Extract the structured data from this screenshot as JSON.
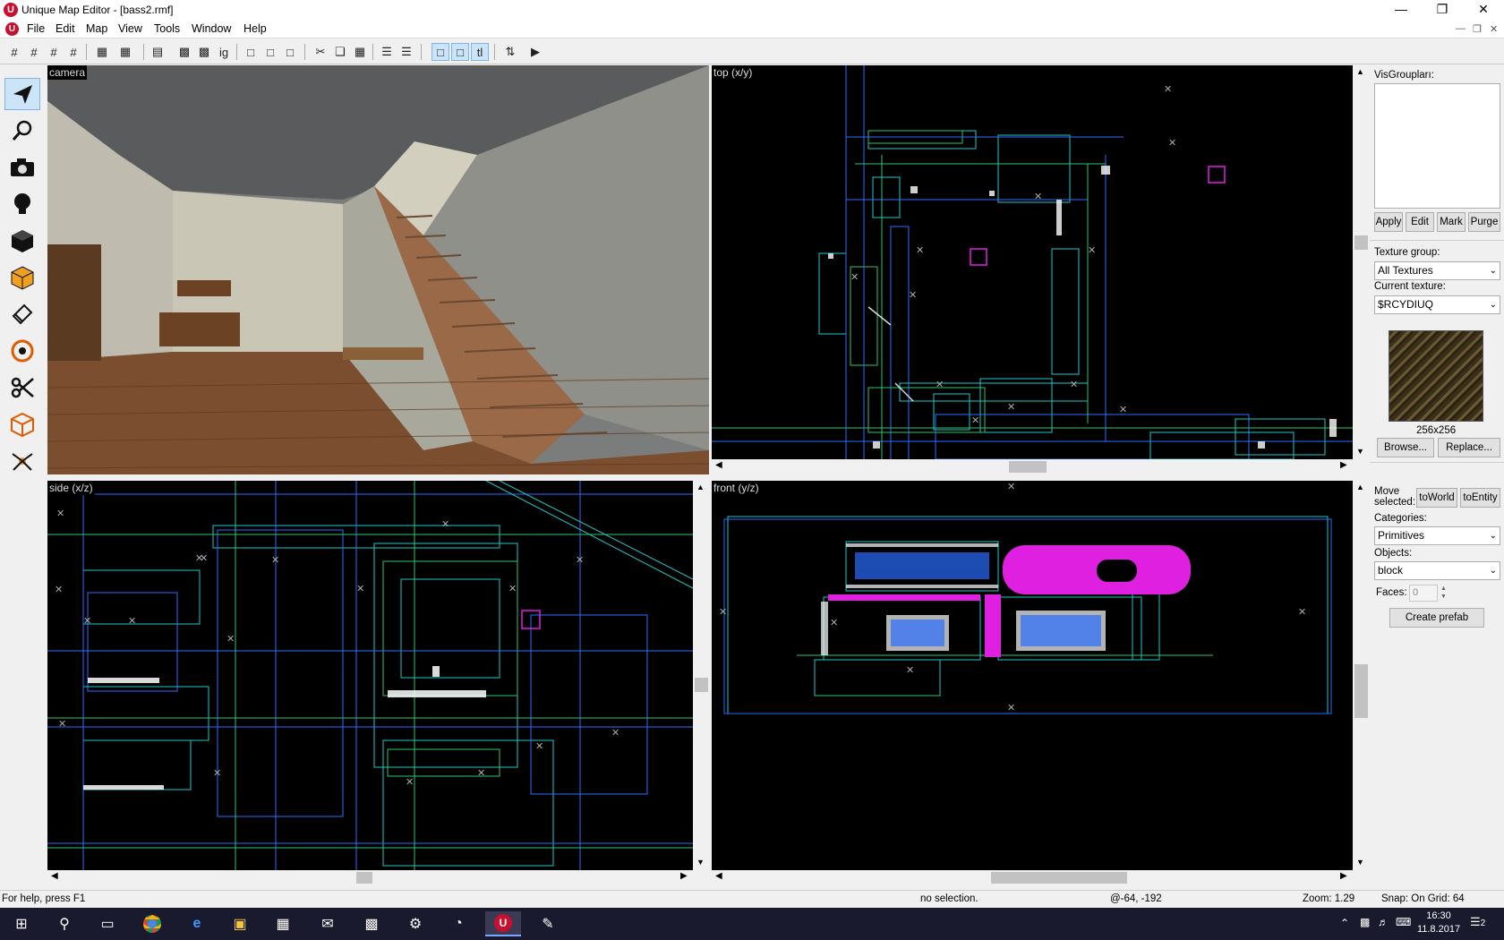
{
  "window": {
    "title": "Unique Map Editor - [bass2.rmf]"
  },
  "menu": [
    "File",
    "Edit",
    "Map",
    "View",
    "Tools",
    "Window",
    "Help"
  ],
  "views": {
    "camera": "camera",
    "top": "top (x/y)",
    "side": "side (x/z)",
    "front": "front (y/z)"
  },
  "panel": {
    "visgroups_label": "VisGroupları:",
    "visgroup_buttons": [
      "Apply",
      "Edit",
      "Mark",
      "Purge"
    ],
    "texture_group_label": "Texture group:",
    "texture_group_value": "All Textures",
    "current_texture_label": "Current texture:",
    "current_texture_value": "$RCYDIUQ",
    "texture_size": "256x256",
    "browse_label": "Browse...",
    "replace_label": "Replace...",
    "move_selected_label": "Move selected:",
    "to_world_label": "toWorld",
    "to_entity_label": "toEntity",
    "categories_label": "Categories:",
    "categories_value": "Primitives",
    "objects_label": "Objects:",
    "objects_value": "block",
    "faces_label": "Faces:",
    "faces_value": "0",
    "create_prefab_label": "Create prefab"
  },
  "status": {
    "help": "For help, press F1",
    "selection": "no selection.",
    "coords": "@-64, -192",
    "zoom": "Zoom: 1.29",
    "snap": "Snap: On Grid: 64"
  },
  "taskbar": {
    "time": "16:30",
    "date": "11.8.2017",
    "notifications": "2"
  },
  "colors": {
    "accent_select": "#cce4f7",
    "grid_blue": "#2a6cff",
    "grid_cyan": "#1fc8c8",
    "grid_green": "#2fc36b",
    "magenta": "#e020e0"
  }
}
